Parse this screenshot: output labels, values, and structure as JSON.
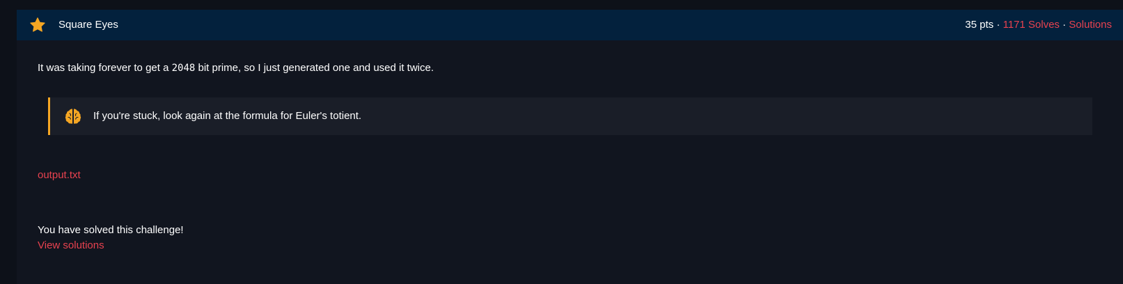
{
  "challenge": {
    "title": "Square Eyes",
    "points": "35 pts",
    "separator": "·",
    "solves_label": "1171 Solves",
    "solutions_label": "Solutions",
    "star_icon": "star-icon",
    "accent_color": "#f5a623",
    "link_color": "#e8424f",
    "header_bg": "#03213d"
  },
  "description": {
    "before": "It was taking forever to get a ",
    "code": "2048",
    "after": " bit prime, so I just generated one and used it twice."
  },
  "hint": {
    "icon": "brain-icon",
    "text": "If you're stuck, look again at the formula for Euler's totient."
  },
  "files": [
    {
      "name": "output.txt"
    }
  ],
  "status": {
    "solved_text": "You have solved this challenge!",
    "view_solutions_label": "View solutions"
  }
}
